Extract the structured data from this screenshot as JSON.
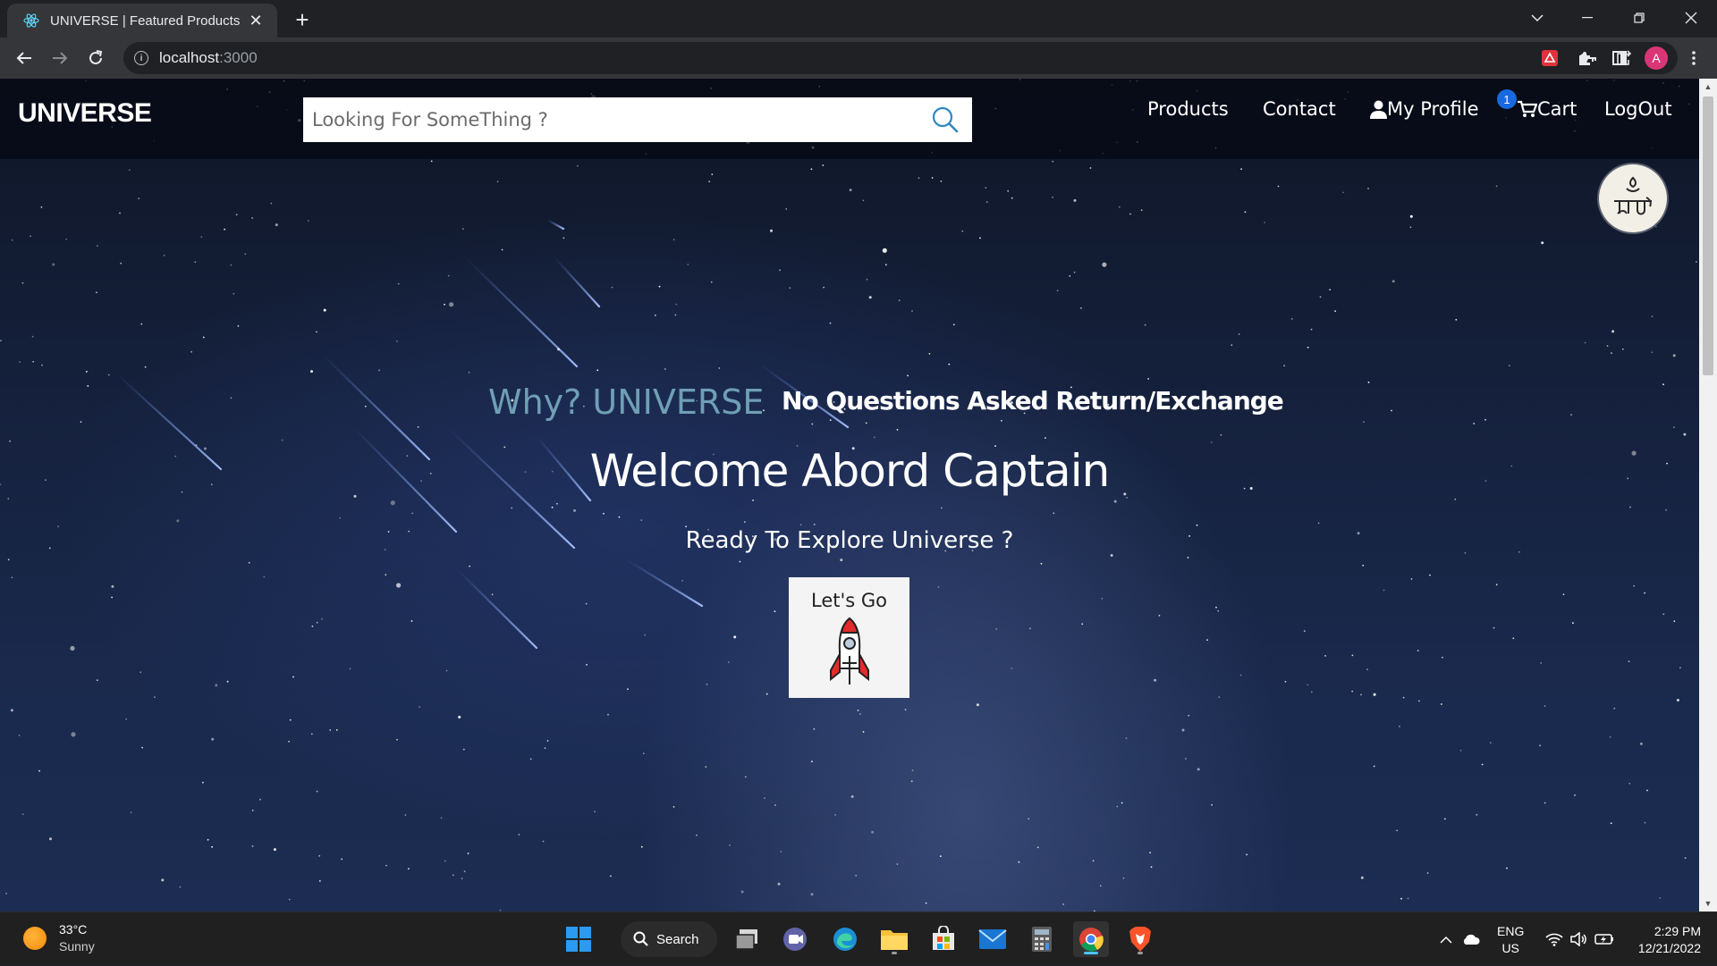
{
  "browser": {
    "tab_title": "UNIVERSE | Featured Products",
    "url_host": "localhost",
    "url_port": ":3000",
    "profile_initial": "A"
  },
  "site": {
    "brand": "UNIVERSE",
    "search_placeholder": "Looking For SomeThing ?",
    "nav": {
      "products": "Products",
      "contact": "Contact",
      "profile": "My Profile",
      "cart": "Cart",
      "cart_count": "1",
      "logout": "LogOut"
    },
    "hero": {
      "why": "Why? UNIVERSE",
      "tagline": "No Questions Asked Return/Exchange",
      "welcome": "Welcome Abord Captain",
      "ready": "Ready To Explore Universe ?",
      "cta": "Let's Go"
    },
    "colors": {
      "why_accent": "#6f9fb5",
      "badge": "#1769e0"
    }
  },
  "taskbar": {
    "weather_temp": "33°C",
    "weather_cond": "Sunny",
    "search_label": "Search",
    "lang_top": "ENG",
    "lang_bottom": "US",
    "time": "2:29 PM",
    "date": "12/21/2022",
    "apps": [
      "start-icon",
      "search-icon",
      "task-view-icon",
      "teams-icon",
      "edge-icon",
      "file-explorer-icon",
      "store-icon",
      "mail-icon",
      "calculator-icon",
      "chrome-icon",
      "brave-icon"
    ]
  }
}
